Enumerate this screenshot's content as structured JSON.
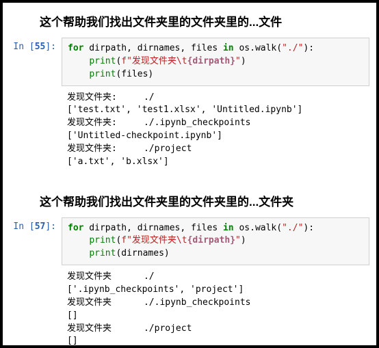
{
  "section1": {
    "title": "这个帮助我们找出文件夹里的文件夹里的...文件",
    "prompt_label": "In [",
    "prompt_num": "55",
    "prompt_close": "]:",
    "code": {
      "kw_for": "for",
      "vars": " dirpath, dirnames, files ",
      "kw_in": "in",
      "oswalk": " os.walk(",
      "path_str": "\"./\"",
      "close_paren": "):",
      "indent": "    ",
      "print1": "print",
      "print1_open": "(",
      "fstr_prefix": "f\"发现文件夹\\t",
      "interp": "{dirpath}",
      "fstr_close": "\"",
      "print1_close": ")",
      "print2": "print",
      "print2_arg": "(files)"
    },
    "output": "发现文件夹:     ./\n['test.txt', 'test1.xlsx', 'Untitled.ipynb']\n发现文件夹:     ./.ipynb_checkpoints\n['Untitled-checkpoint.ipynb']\n发现文件夹:     ./project\n['a.txt', 'b.xlsx']"
  },
  "section2": {
    "title": "这个帮助我们找出文件夹里的文件夹里的...文件夹",
    "prompt_label": "In [",
    "prompt_num": "57",
    "prompt_close": "]:",
    "code": {
      "kw_for": "for",
      "vars": " dirpath, dirnames, files ",
      "kw_in": "in",
      "oswalk": " os.walk(",
      "path_str": "\"./\"",
      "close_paren": "):",
      "indent": "    ",
      "print1": "print",
      "print1_open": "(",
      "fstr_prefix": "f\"发现文件夹\\t",
      "interp": "{dirpath}",
      "fstr_close": "\"",
      "print1_close": ")",
      "print2": "print",
      "print2_arg": "(dirnames)"
    },
    "output": "发现文件夹      ./\n['.ipynb_checkpoints', 'project']\n发现文件夹      ./.ipynb_checkpoints\n[]\n发现文件夹      ./project\n[]"
  }
}
